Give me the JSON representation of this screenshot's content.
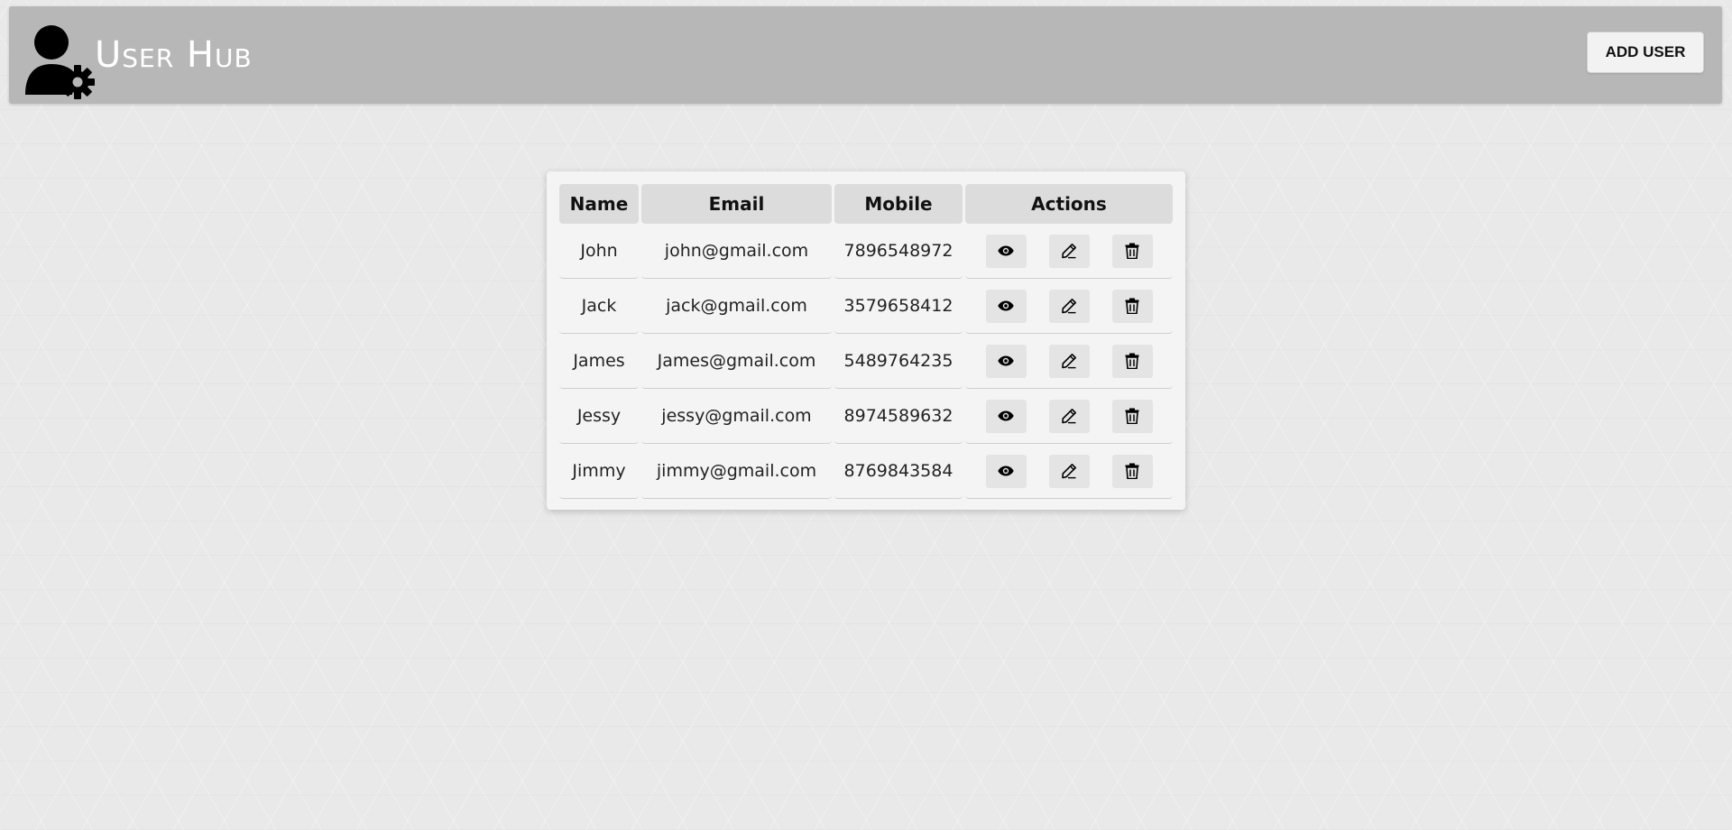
{
  "header": {
    "title": "User Hub",
    "add_user_label": "ADD USER",
    "logo_icon": "user-gear-icon"
  },
  "table": {
    "columns": [
      "Name",
      "Email",
      "Mobile",
      "Actions"
    ],
    "rows": [
      {
        "name": "John",
        "email": "john@gmail.com",
        "mobile": "7896548972"
      },
      {
        "name": "Jack",
        "email": "jack@gmail.com",
        "mobile": "3579658412"
      },
      {
        "name": "James",
        "email": "James@gmail.com",
        "mobile": "5489764235"
      },
      {
        "name": "Jessy",
        "email": "jessy@gmail.com",
        "mobile": "8974589632"
      },
      {
        "name": "Jimmy",
        "email": "jimmy@gmail.com",
        "mobile": "8769843584"
      }
    ],
    "row_actions": [
      {
        "name": "view",
        "icon": "eye-icon"
      },
      {
        "name": "edit",
        "icon": "pencil-icon"
      },
      {
        "name": "delete",
        "icon": "trash-icon"
      }
    ]
  },
  "colors": {
    "header_bg": "#b7b7b7",
    "page_bg": "#e9e9e9",
    "title_text": "#ffffff"
  }
}
